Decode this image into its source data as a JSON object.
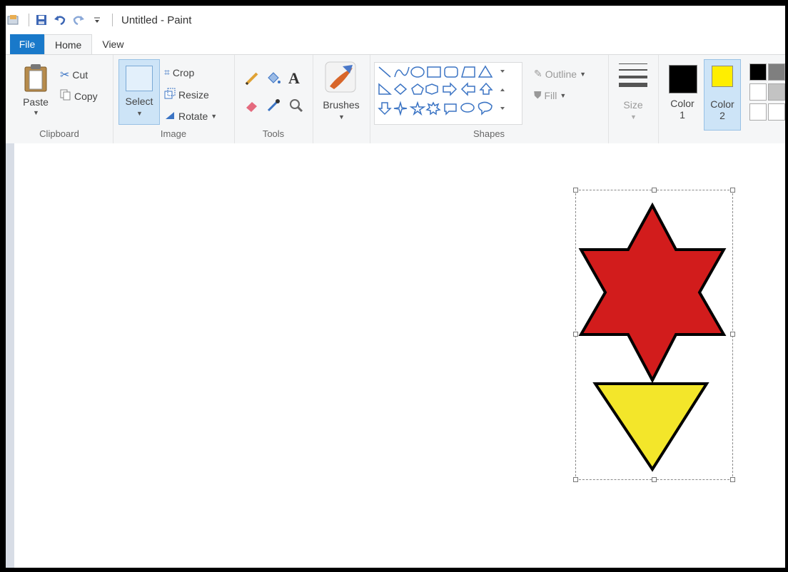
{
  "titlebar": {
    "title": "Untitled - Paint",
    "icons": [
      "paint-app-icon",
      "save-icon",
      "undo-icon",
      "redo-icon",
      "customize-icon"
    ]
  },
  "tabs": [
    "File",
    "Home",
    "View"
  ],
  "ribbon": {
    "clipboard": {
      "paste": "Paste",
      "cut": "Cut",
      "copy": "Copy",
      "label": "Clipboard"
    },
    "image": {
      "select": "Select",
      "crop": "Crop",
      "resize": "Resize",
      "rotate": "Rotate",
      "label": "Image"
    },
    "tools": {
      "label": "Tools"
    },
    "brushes": {
      "label": "Brushes"
    },
    "shapes": {
      "label": "Shapes",
      "outline": "Outline",
      "fill": "Fill"
    },
    "size": {
      "label": "Size"
    },
    "colors": {
      "color1_line1": "Color",
      "color1_line2": "1",
      "color2_line1": "Color",
      "color2_line2": "2",
      "color1_value": "#000000",
      "color2_value": "#ffee00"
    }
  },
  "canvas": {
    "shapes": [
      {
        "type": "six-point-star",
        "fill": "#d21c1c",
        "outline": "#000000"
      },
      {
        "type": "down-triangle",
        "fill": "#f3e62a",
        "outline": "#000000"
      }
    ]
  }
}
